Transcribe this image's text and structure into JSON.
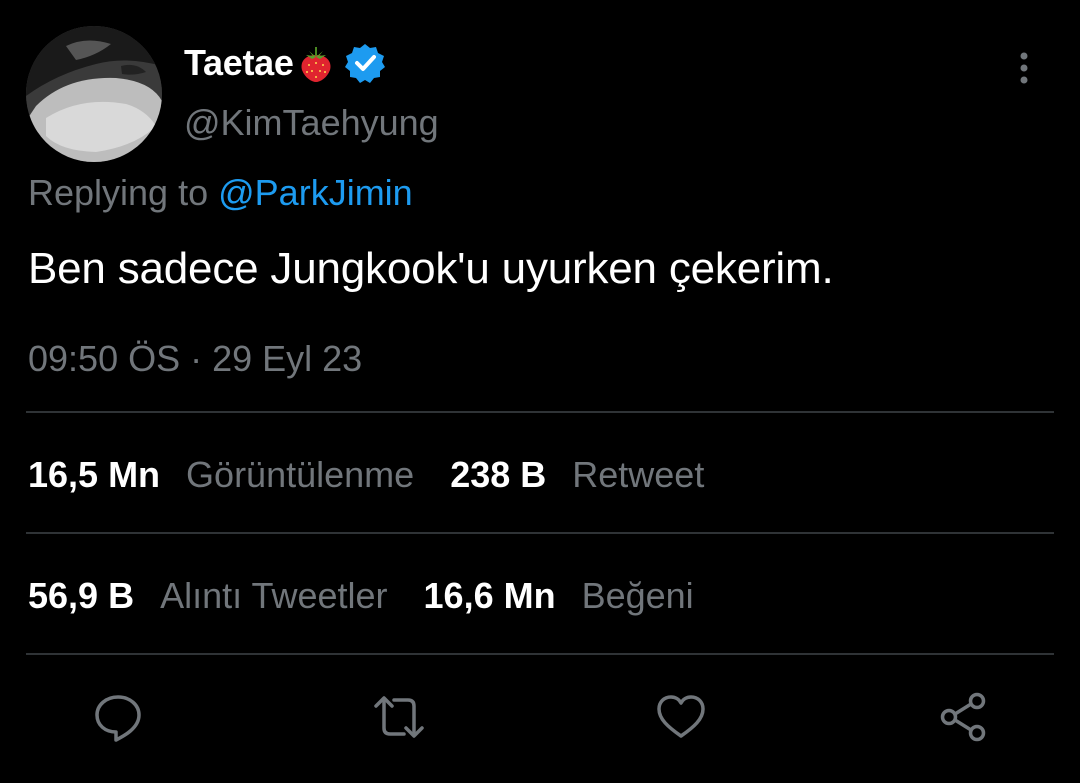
{
  "tweet": {
    "display_name": "Taetae",
    "name_emoji": "strawberry-emoji",
    "verified": true,
    "handle": "@KimTaehyung",
    "replying_prefix": "Replying to",
    "replying_to": "@ParkJimin",
    "text": "Ben sadece Jungkook'u uyurken çekerim.",
    "timestamp": "09:50 ÖS · 29 Eyl 23"
  },
  "stats": {
    "views_count": "16,5 Mn",
    "views_label": "Görüntülenme",
    "retweets_count": "238 B",
    "retweets_label": "Retweet",
    "quotes_count": "56,9 B",
    "quotes_label": "Alıntı Tweetler",
    "likes_count": "16,6 Mn",
    "likes_label": "Beğeni"
  },
  "actions": [
    "reply-icon",
    "retweet-icon",
    "like-icon",
    "share-icon"
  ],
  "colors": {
    "background": "#000000",
    "text": "#ffffff",
    "secondary": "#71767b",
    "accent": "#1d9bf0",
    "divider": "#2f3336"
  }
}
